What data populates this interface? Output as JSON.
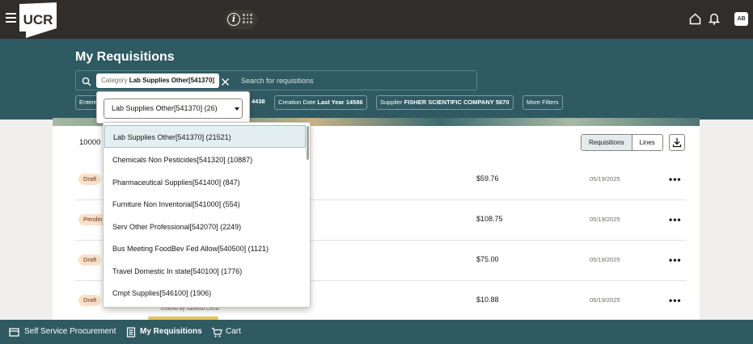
{
  "topbar": {
    "logo_text": "UCR",
    "avatar_initials": "AB",
    "icons": [
      "hamburger-icon",
      "info-icon",
      "grid-icon",
      "home-icon",
      "bell-icon"
    ]
  },
  "header": {
    "title": "My Requisitions"
  },
  "search": {
    "active_chip_label": "Category",
    "active_chip_value": "Lab Supplies Other[541370]",
    "placeholder": "Search for requisitions"
  },
  "filters": {
    "entered_prefix": "Entere",
    "partial_value": "4438",
    "creation_label": "Creation Date",
    "creation_value": "Last Year",
    "creation_count": "14586",
    "supplier_label": "Supplier",
    "supplier_value": "FISHER SCIENTIFIC COMPANY",
    "supplier_count": "5670",
    "more_label": "More Filters"
  },
  "dropdown": {
    "selected": "Lab Supplies Other[541370] (26)",
    "options": [
      "Lab Supplies Other[541370] (21521)",
      "Chemicals Non Pesticides[541320] (10887)",
      "Pharmaceutical Supplies[541400] (847)",
      "Furniture Non Inventorial[541000] (554)",
      "Serv Other Professional[542070] (2249)",
      "Bus Meeting FoodBev Fed Allow[540500] (1121)",
      "Travel Domestic In state[540100] (1776)",
      "Cmpt Supplies[546100] (1906)"
    ]
  },
  "results": {
    "count": "10000",
    "view_requisitions": "Requisitions",
    "view_lines": "Lines",
    "rows": [
      {
        "status": "Draft",
        "amount": "$59.76",
        "date": "05/19/2025"
      },
      {
        "status": "Pendin",
        "amount": "$108.75",
        "date": "05/19/2025"
      },
      {
        "status": "Draft",
        "amount": "$75.00",
        "date": "05/19/2025"
      },
      {
        "status": "Draft",
        "amount": "$10.88",
        "date": "05/19/2025"
      }
    ],
    "more_glyph": "•••",
    "entered_by": "Entered By Valencia Corral"
  },
  "bottom_nav": {
    "items": [
      "Self Service Procurement",
      "My Requisitions",
      "Cart"
    ]
  },
  "colors": {
    "topbar": "#312d2a",
    "header_band": "#2f5a62",
    "accent_underline": "#e6c25a",
    "badge_bg": "#fbe0c9"
  }
}
